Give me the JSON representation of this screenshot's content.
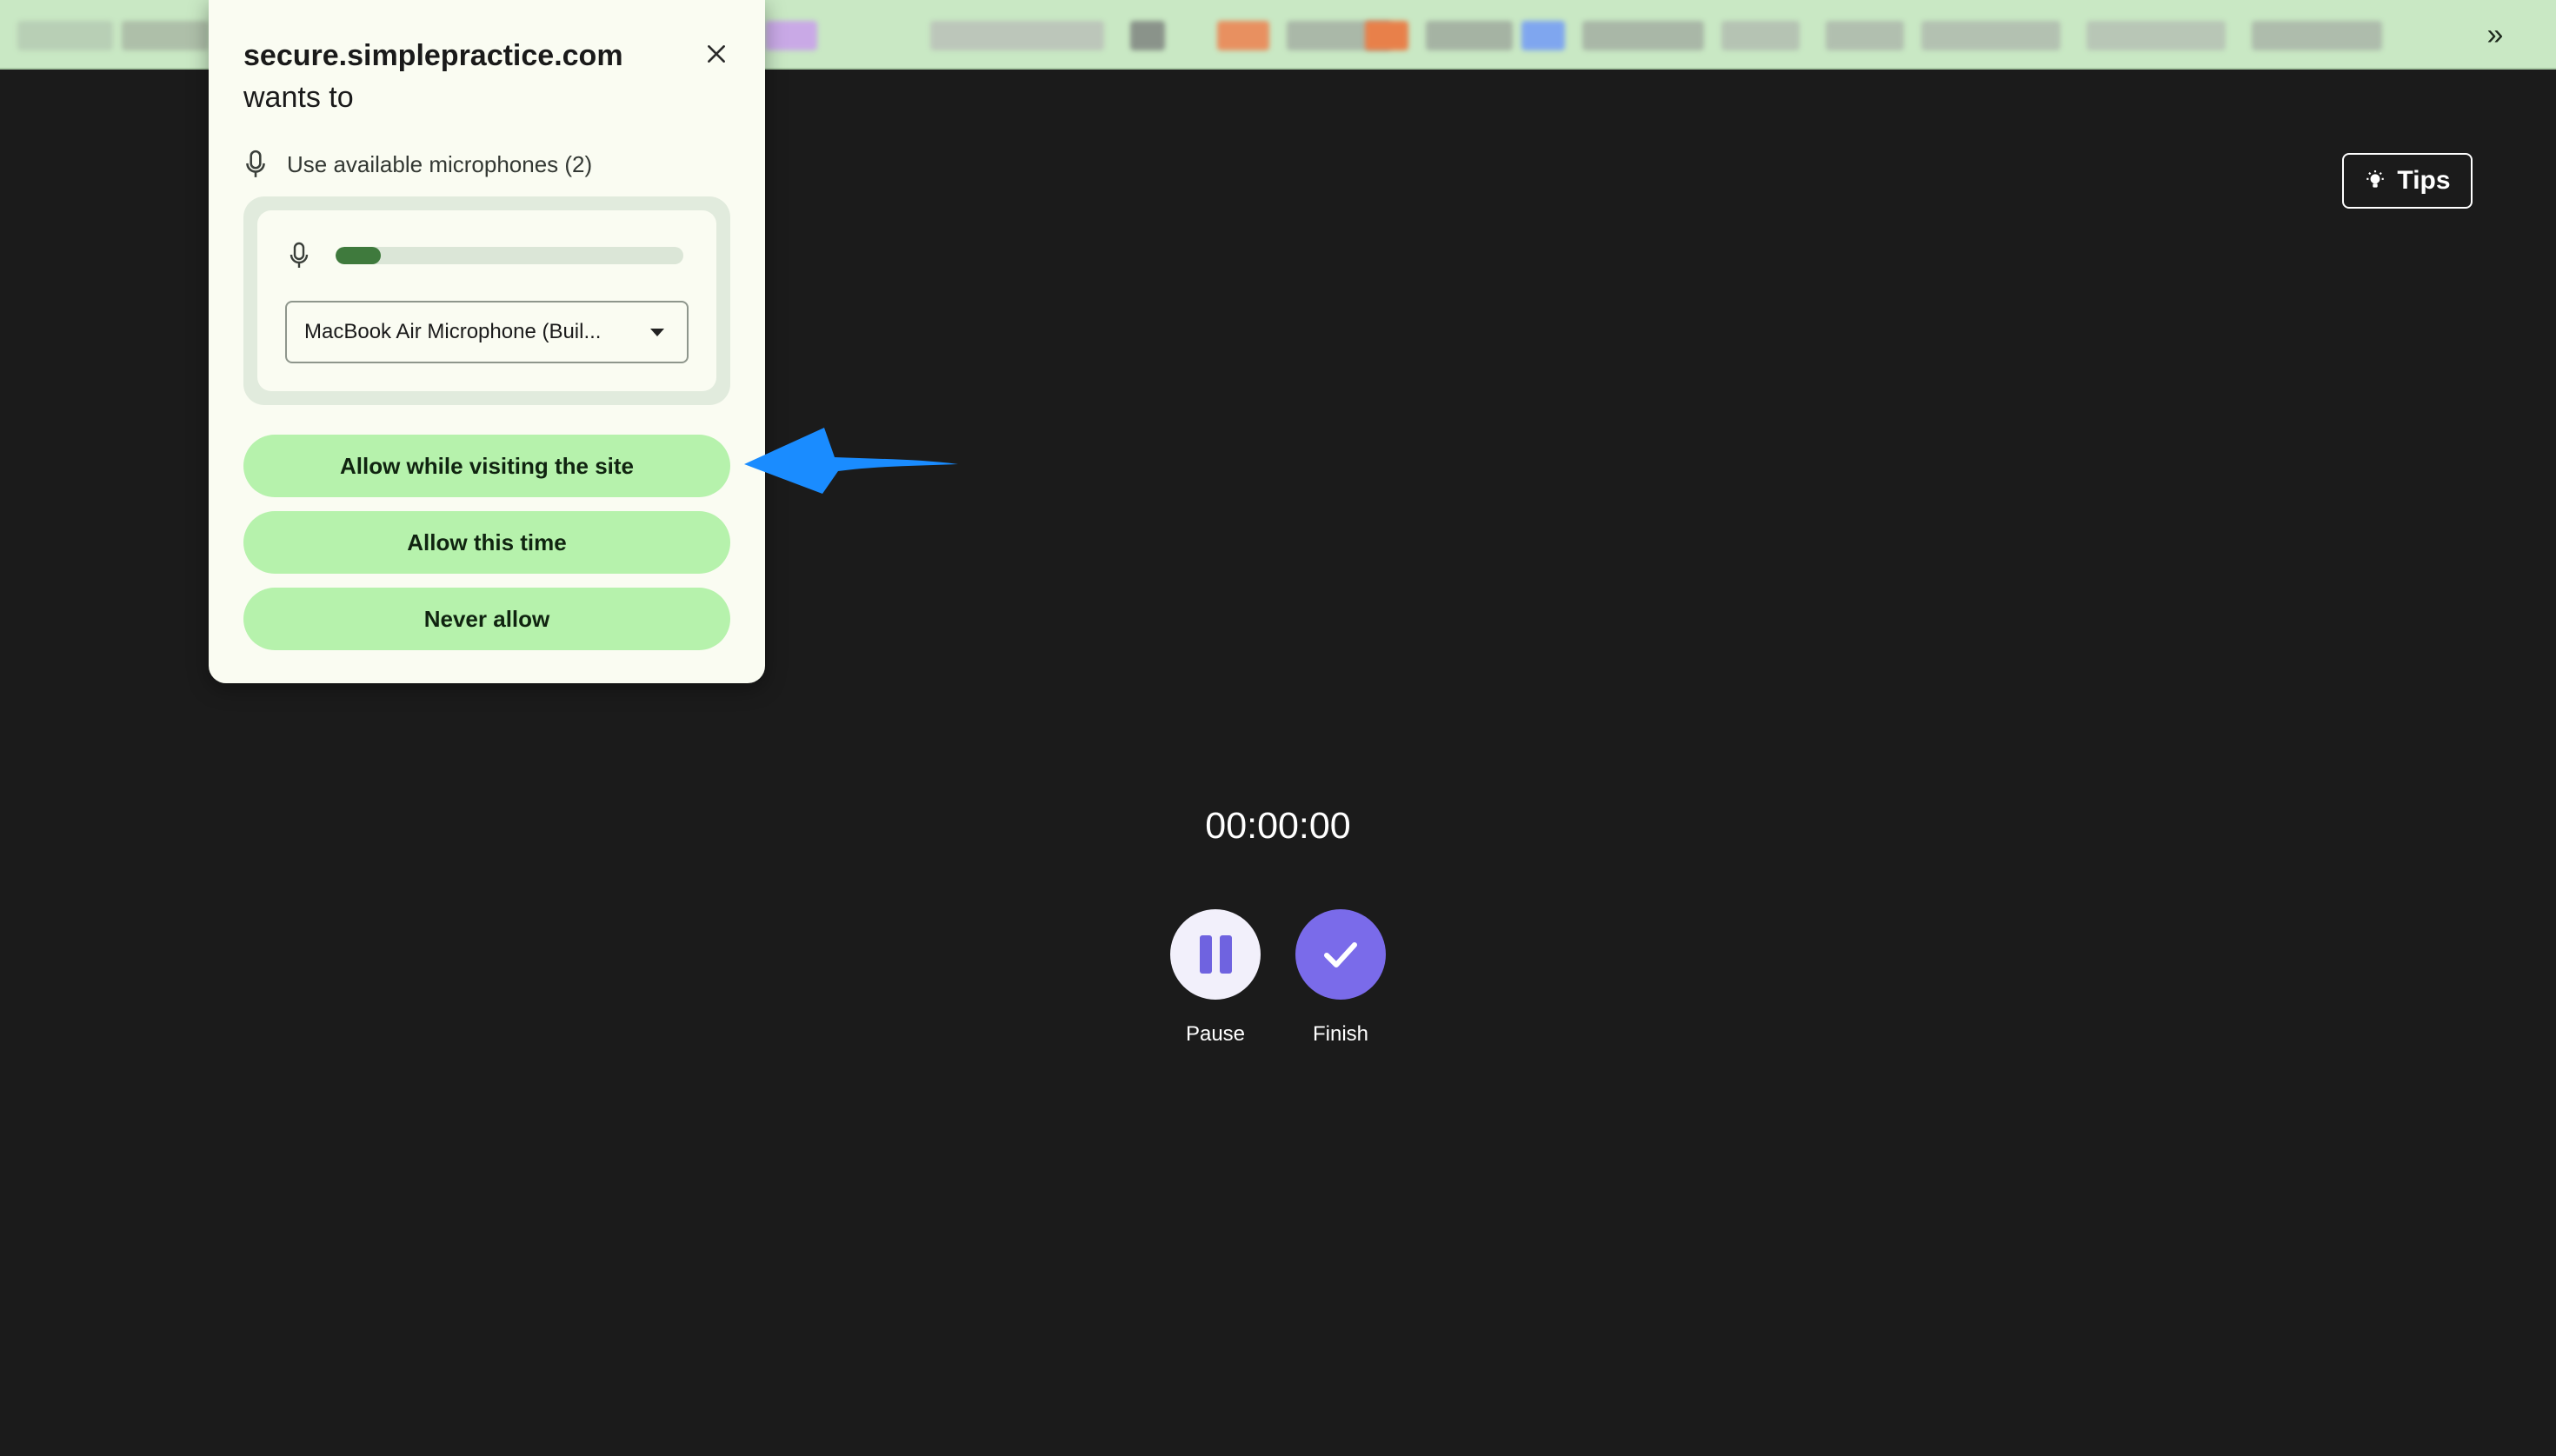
{
  "bookmarks_bar": {
    "overflow_icon": "double-chevron-right-icon",
    "overflow_glyph": "»",
    "blobs": [
      {
        "color": "#b8cfb5"
      },
      {
        "color": "#aebfa9"
      },
      {
        "color": "#b9c9b4"
      },
      {
        "color": "#c9a9e6"
      },
      {
        "color": "#bcc6ba"
      },
      {
        "color": "#8a938a"
      },
      {
        "color": "#e89060"
      },
      {
        "color": "#aab8a8"
      },
      {
        "color": "#e8804a"
      },
      {
        "color": "#a5b3a3"
      },
      {
        "color": "#7fa6ef"
      },
      {
        "color": "#a9b7a7"
      },
      {
        "color": "#b5c3b3"
      },
      {
        "color": "#b1bfaf"
      },
      {
        "color": "#b3c1b1"
      },
      {
        "color": "#b8c6b6"
      },
      {
        "color": "#aebcac"
      }
    ]
  },
  "tips": {
    "label": "Tips",
    "icon": "lightbulb-icon"
  },
  "recorder": {
    "timer": "00:00:00",
    "pause_label": "Pause",
    "finish_label": "Finish",
    "pause_icon": "pause-icon",
    "finish_icon": "checkmark-icon"
  },
  "permission_popup": {
    "site": "secure.simplepractice.com",
    "wants": "wants to",
    "request": "Use available microphones (2)",
    "mic_level": 0.13,
    "selected_microphone": "MacBook Air Microphone (Buil...",
    "allow_site_label": "Allow while visiting the site",
    "allow_once_label": "Allow this time",
    "never_allow_label": "Never allow",
    "close_icon": "close-icon",
    "mic_icon": "microphone-icon"
  },
  "colors": {
    "page_background": "#1b1b1b",
    "bookmarks_bar": "#c9e8c4",
    "popup_background": "#fafcf2",
    "permission_button": "#b6f2ac",
    "mic_level_fill": "#3f7a3d",
    "accent_purple": "#7a6bea",
    "arrow_blue": "#1a8cff"
  }
}
